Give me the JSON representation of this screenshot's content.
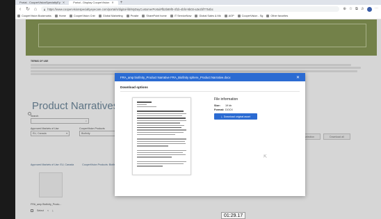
{
  "browser": {
    "tabs": [
      {
        "label": "Portal - CooperVisionSpecialtyEy",
        "active": false
      },
      {
        "label": "Portal - Display CooperVision",
        "active": true
      }
    ],
    "url": "https://www.coopervisionspecialtyeyecare.com/portal/s/digital-lib/MyDayCustomerPortal#fb2b89f0-4f1b-4bf4-9b03-a3e2bf7754bc",
    "bookmarks": [
      "CooperVision Bookmarks",
      "Home",
      "CooperVision Cntr",
      "Global Marketing",
      "Prosite",
      "SharePoint home",
      "IT ServiceNow",
      "Global Sales & Mk",
      "AOP",
      "CooperVision - Sg",
      "Other favorites"
    ]
  },
  "page": {
    "terms_title": "TERMS OF USE",
    "heading": "Product Narratives",
    "search_label": "Search",
    "approved_label": "Approved Markets of Use",
    "approved_value": "EU, Canada",
    "products_label": "CooperVision Products",
    "products_value": "Biofinity",
    "right_button_1": "Download selection",
    "right_button_2": "Download all",
    "list_link_1": "Approved Markets of Use: EU, Canada",
    "list_link_2": "CooperVision Products: Biofinity",
    "thumb_caption": "FRA_amp Biofinity_Produ...",
    "select_label": "Select"
  },
  "modal": {
    "title": "FRA_amp biofinity_Product Narrative FRA_Biofinity sphere_Product Narrative.docx",
    "subtitle": "Download options",
    "file_info_title": "File information",
    "size_key": "Size:",
    "size_value": "19 kb",
    "format_key": "Format:",
    "format_value": "DOCX",
    "download_label": "Download original asset"
  },
  "video": {
    "timestamp": "01:29.17"
  },
  "colors": {
    "accent": "#2b6bd2",
    "banner": "#8a9a58",
    "heading": "#6f8a9e"
  }
}
